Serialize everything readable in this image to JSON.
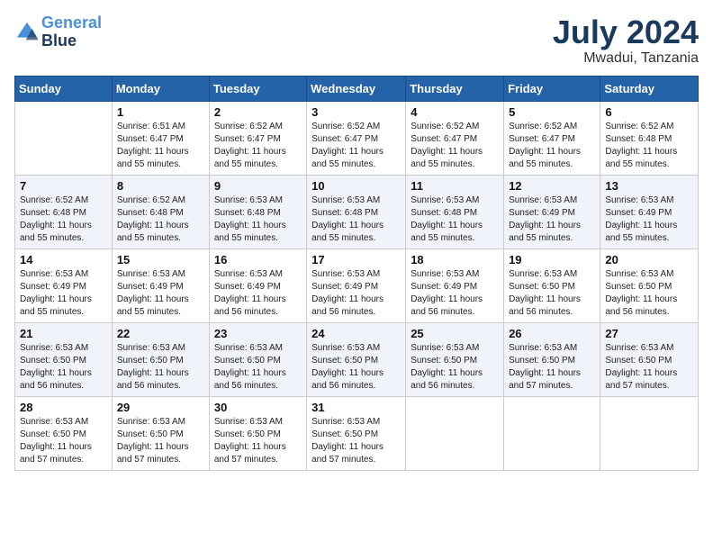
{
  "header": {
    "logo_line1": "General",
    "logo_line2": "Blue",
    "month_year": "July 2024",
    "location": "Mwadui, Tanzania"
  },
  "weekdays": [
    "Sunday",
    "Monday",
    "Tuesday",
    "Wednesday",
    "Thursday",
    "Friday",
    "Saturday"
  ],
  "weeks": [
    [
      {
        "day": "",
        "sunrise": "",
        "sunset": "",
        "daylight": ""
      },
      {
        "day": "1",
        "sunrise": "Sunrise: 6:51 AM",
        "sunset": "Sunset: 6:47 PM",
        "daylight": "Daylight: 11 hours and 55 minutes."
      },
      {
        "day": "2",
        "sunrise": "Sunrise: 6:52 AM",
        "sunset": "Sunset: 6:47 PM",
        "daylight": "Daylight: 11 hours and 55 minutes."
      },
      {
        "day": "3",
        "sunrise": "Sunrise: 6:52 AM",
        "sunset": "Sunset: 6:47 PM",
        "daylight": "Daylight: 11 hours and 55 minutes."
      },
      {
        "day": "4",
        "sunrise": "Sunrise: 6:52 AM",
        "sunset": "Sunset: 6:47 PM",
        "daylight": "Daylight: 11 hours and 55 minutes."
      },
      {
        "day": "5",
        "sunrise": "Sunrise: 6:52 AM",
        "sunset": "Sunset: 6:47 PM",
        "daylight": "Daylight: 11 hours and 55 minutes."
      },
      {
        "day": "6",
        "sunrise": "Sunrise: 6:52 AM",
        "sunset": "Sunset: 6:48 PM",
        "daylight": "Daylight: 11 hours and 55 minutes."
      }
    ],
    [
      {
        "day": "7",
        "sunrise": "Sunrise: 6:52 AM",
        "sunset": "Sunset: 6:48 PM",
        "daylight": "Daylight: 11 hours and 55 minutes."
      },
      {
        "day": "8",
        "sunrise": "Sunrise: 6:52 AM",
        "sunset": "Sunset: 6:48 PM",
        "daylight": "Daylight: 11 hours and 55 minutes."
      },
      {
        "day": "9",
        "sunrise": "Sunrise: 6:53 AM",
        "sunset": "Sunset: 6:48 PM",
        "daylight": "Daylight: 11 hours and 55 minutes."
      },
      {
        "day": "10",
        "sunrise": "Sunrise: 6:53 AM",
        "sunset": "Sunset: 6:48 PM",
        "daylight": "Daylight: 11 hours and 55 minutes."
      },
      {
        "day": "11",
        "sunrise": "Sunrise: 6:53 AM",
        "sunset": "Sunset: 6:48 PM",
        "daylight": "Daylight: 11 hours and 55 minutes."
      },
      {
        "day": "12",
        "sunrise": "Sunrise: 6:53 AM",
        "sunset": "Sunset: 6:49 PM",
        "daylight": "Daylight: 11 hours and 55 minutes."
      },
      {
        "day": "13",
        "sunrise": "Sunrise: 6:53 AM",
        "sunset": "Sunset: 6:49 PM",
        "daylight": "Daylight: 11 hours and 55 minutes."
      }
    ],
    [
      {
        "day": "14",
        "sunrise": "Sunrise: 6:53 AM",
        "sunset": "Sunset: 6:49 PM",
        "daylight": "Daylight: 11 hours and 55 minutes."
      },
      {
        "day": "15",
        "sunrise": "Sunrise: 6:53 AM",
        "sunset": "Sunset: 6:49 PM",
        "daylight": "Daylight: 11 hours and 55 minutes."
      },
      {
        "day": "16",
        "sunrise": "Sunrise: 6:53 AM",
        "sunset": "Sunset: 6:49 PM",
        "daylight": "Daylight: 11 hours and 56 minutes."
      },
      {
        "day": "17",
        "sunrise": "Sunrise: 6:53 AM",
        "sunset": "Sunset: 6:49 PM",
        "daylight": "Daylight: 11 hours and 56 minutes."
      },
      {
        "day": "18",
        "sunrise": "Sunrise: 6:53 AM",
        "sunset": "Sunset: 6:49 PM",
        "daylight": "Daylight: 11 hours and 56 minutes."
      },
      {
        "day": "19",
        "sunrise": "Sunrise: 6:53 AM",
        "sunset": "Sunset: 6:50 PM",
        "daylight": "Daylight: 11 hours and 56 minutes."
      },
      {
        "day": "20",
        "sunrise": "Sunrise: 6:53 AM",
        "sunset": "Sunset: 6:50 PM",
        "daylight": "Daylight: 11 hours and 56 minutes."
      }
    ],
    [
      {
        "day": "21",
        "sunrise": "Sunrise: 6:53 AM",
        "sunset": "Sunset: 6:50 PM",
        "daylight": "Daylight: 11 hours and 56 minutes."
      },
      {
        "day": "22",
        "sunrise": "Sunrise: 6:53 AM",
        "sunset": "Sunset: 6:50 PM",
        "daylight": "Daylight: 11 hours and 56 minutes."
      },
      {
        "day": "23",
        "sunrise": "Sunrise: 6:53 AM",
        "sunset": "Sunset: 6:50 PM",
        "daylight": "Daylight: 11 hours and 56 minutes."
      },
      {
        "day": "24",
        "sunrise": "Sunrise: 6:53 AM",
        "sunset": "Sunset: 6:50 PM",
        "daylight": "Daylight: 11 hours and 56 minutes."
      },
      {
        "day": "25",
        "sunrise": "Sunrise: 6:53 AM",
        "sunset": "Sunset: 6:50 PM",
        "daylight": "Daylight: 11 hours and 56 minutes."
      },
      {
        "day": "26",
        "sunrise": "Sunrise: 6:53 AM",
        "sunset": "Sunset: 6:50 PM",
        "daylight": "Daylight: 11 hours and 57 minutes."
      },
      {
        "day": "27",
        "sunrise": "Sunrise: 6:53 AM",
        "sunset": "Sunset: 6:50 PM",
        "daylight": "Daylight: 11 hours and 57 minutes."
      }
    ],
    [
      {
        "day": "28",
        "sunrise": "Sunrise: 6:53 AM",
        "sunset": "Sunset: 6:50 PM",
        "daylight": "Daylight: 11 hours and 57 minutes."
      },
      {
        "day": "29",
        "sunrise": "Sunrise: 6:53 AM",
        "sunset": "Sunset: 6:50 PM",
        "daylight": "Daylight: 11 hours and 57 minutes."
      },
      {
        "day": "30",
        "sunrise": "Sunrise: 6:53 AM",
        "sunset": "Sunset: 6:50 PM",
        "daylight": "Daylight: 11 hours and 57 minutes."
      },
      {
        "day": "31",
        "sunrise": "Sunrise: 6:53 AM",
        "sunset": "Sunset: 6:50 PM",
        "daylight": "Daylight: 11 hours and 57 minutes."
      },
      {
        "day": "",
        "sunrise": "",
        "sunset": "",
        "daylight": ""
      },
      {
        "day": "",
        "sunrise": "",
        "sunset": "",
        "daylight": ""
      },
      {
        "day": "",
        "sunrise": "",
        "sunset": "",
        "daylight": ""
      }
    ]
  ]
}
